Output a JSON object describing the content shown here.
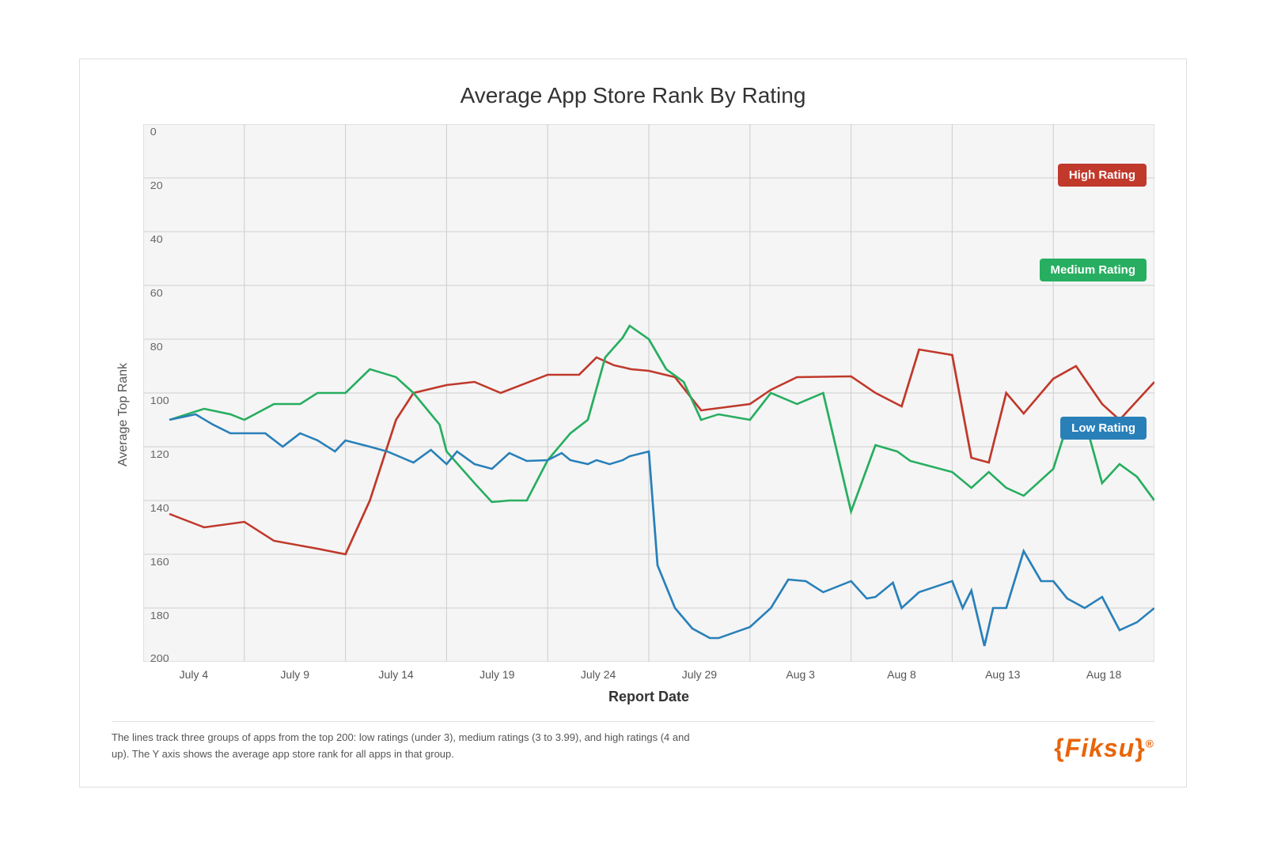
{
  "chart": {
    "title": "Average App Store Rank By Rating",
    "x_axis_label": "Report Date",
    "y_axis_label": "Average Top Rank",
    "x_labels": [
      "July 4",
      "July 9",
      "July 14",
      "July 19",
      "July 24",
      "July 29",
      "Aug 3",
      "Aug 8",
      "Aug 13",
      "Aug 18"
    ],
    "y_labels": [
      "0",
      "20",
      "40",
      "60",
      "80",
      "100",
      "120",
      "140",
      "160",
      "180",
      "200"
    ],
    "legend": {
      "high": "High Rating",
      "medium": "Medium Rating",
      "low": "Low Rating"
    },
    "colors": {
      "high": "#c0392b",
      "medium": "#27ae60",
      "low": "#2980b9",
      "grid": "#e0e0e0",
      "background": "#f5f5f5"
    }
  },
  "footer": {
    "description": "The lines track three groups of apps from the top 200: low ratings (under 3), medium ratings (3 to 3.99), and high ratings (4 and up). The Y axis shows the average app store rank for all apps in that group.",
    "logo": "{Fiksu}",
    "logo_text": "Fiksu"
  }
}
